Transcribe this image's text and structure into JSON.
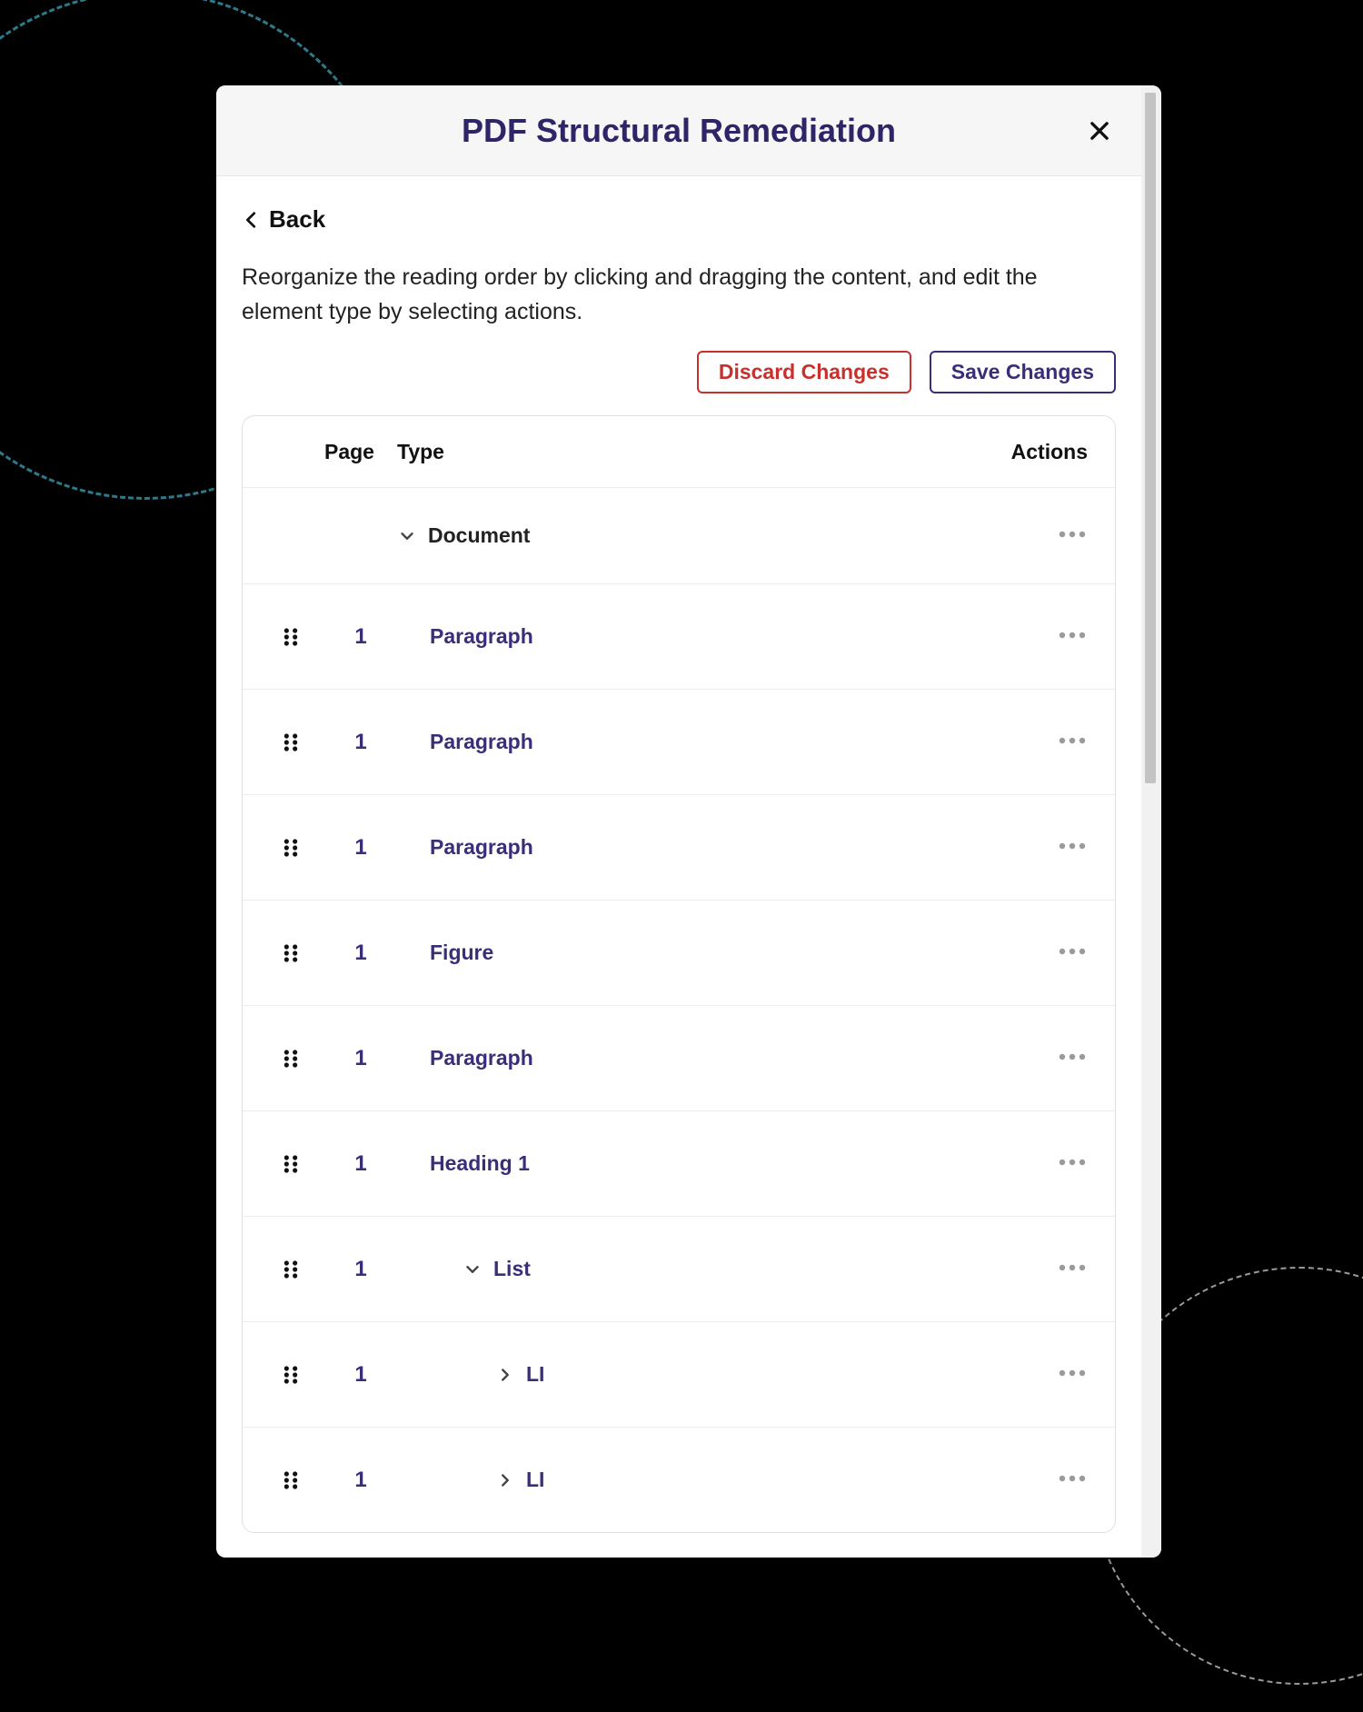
{
  "dialog": {
    "title": "PDF Structural Remediation",
    "close_label": "Close"
  },
  "back": {
    "label": "Back"
  },
  "description": "Reorganize the reading order by clicking and dragging the content, and edit the element type by selecting actions.",
  "buttons": {
    "discard": "Discard Changes",
    "save": "Save Changes"
  },
  "table": {
    "headers": {
      "page": "Page",
      "type": "Type",
      "actions": "Actions"
    },
    "rows": [
      {
        "drag": false,
        "page": "",
        "type_label": "Document",
        "expandable": true,
        "expand_icon": "down",
        "indent": 0,
        "strong": false
      },
      {
        "drag": true,
        "page": "1",
        "type_label": "Paragraph",
        "expandable": false,
        "expand_icon": "",
        "indent": 1,
        "strong": true
      },
      {
        "drag": true,
        "page": "1",
        "type_label": "Paragraph",
        "expandable": false,
        "expand_icon": "",
        "indent": 1,
        "strong": true
      },
      {
        "drag": true,
        "page": "1",
        "type_label": "Paragraph",
        "expandable": false,
        "expand_icon": "",
        "indent": 1,
        "strong": true
      },
      {
        "drag": true,
        "page": "1",
        "type_label": "Figure",
        "expandable": false,
        "expand_icon": "",
        "indent": 1,
        "strong": true
      },
      {
        "drag": true,
        "page": "1",
        "type_label": "Paragraph",
        "expandable": false,
        "expand_icon": "",
        "indent": 1,
        "strong": true
      },
      {
        "drag": true,
        "page": "1",
        "type_label": "Heading 1",
        "expandable": false,
        "expand_icon": "",
        "indent": 1,
        "strong": true
      },
      {
        "drag": true,
        "page": "1",
        "type_label": "List",
        "expandable": true,
        "expand_icon": "down",
        "indent": 2,
        "strong": true
      },
      {
        "drag": true,
        "page": "1",
        "type_label": "LI",
        "expandable": true,
        "expand_icon": "right",
        "indent": 3,
        "strong": true
      },
      {
        "drag": true,
        "page": "1",
        "type_label": "LI",
        "expandable": true,
        "expand_icon": "right",
        "indent": 3,
        "strong": true
      }
    ]
  },
  "colors": {
    "accent": "#3b2e78",
    "danger": "#c9302c"
  }
}
